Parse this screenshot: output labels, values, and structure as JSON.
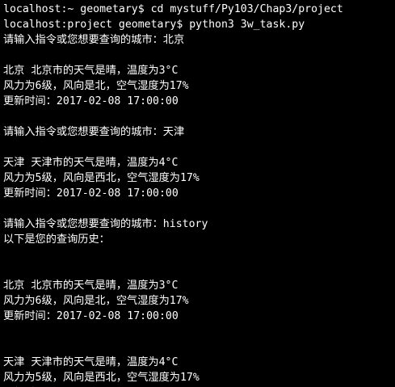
{
  "terminal": {
    "lines": [
      {
        "text": "localhost:~ geometary$ cd mystuff/Py103/Chap3/project"
      },
      {
        "text": "localhost:project geometary$ python3 3w_task.py"
      },
      {
        "text": "请输入指令或您想要查询的城市：北京"
      },
      {
        "text": ""
      },
      {
        "text": "北京 北京市的天气是晴，温度为3°C"
      },
      {
        "text": "风力为6级，风向是北，空气湿度为17%"
      },
      {
        "text": "更新时间：2017-02-08 17:00:00"
      },
      {
        "text": ""
      },
      {
        "text": "请输入指令或您想要查询的城市：天津"
      },
      {
        "text": ""
      },
      {
        "text": "天津 天津市的天气是晴，温度为4°C"
      },
      {
        "text": "风力为5级，风向是西北，空气湿度为17%"
      },
      {
        "text": "更新时间：2017-02-08 17:00:00"
      },
      {
        "text": ""
      },
      {
        "text": "请输入指令或您想要查询的城市：history"
      },
      {
        "text": "以下是您的查询历史："
      },
      {
        "text": ""
      },
      {
        "text": ""
      },
      {
        "text": "北京 北京市的天气是晴，温度为3°C"
      },
      {
        "text": "风力为6级，风向是北，空气湿度为17%"
      },
      {
        "text": "更新时间：2017-02-08 17:00:00"
      },
      {
        "text": ""
      },
      {
        "text": ""
      },
      {
        "text": "天津 天津市的天气是晴，温度为4°C"
      },
      {
        "text": "风力为5级，风向是西北，空气湿度为17%"
      },
      {
        "text": "更新时间：2017-02-08 17:00:00"
      }
    ]
  },
  "colors": {
    "background": "#000000",
    "foreground": "#ffffff"
  }
}
